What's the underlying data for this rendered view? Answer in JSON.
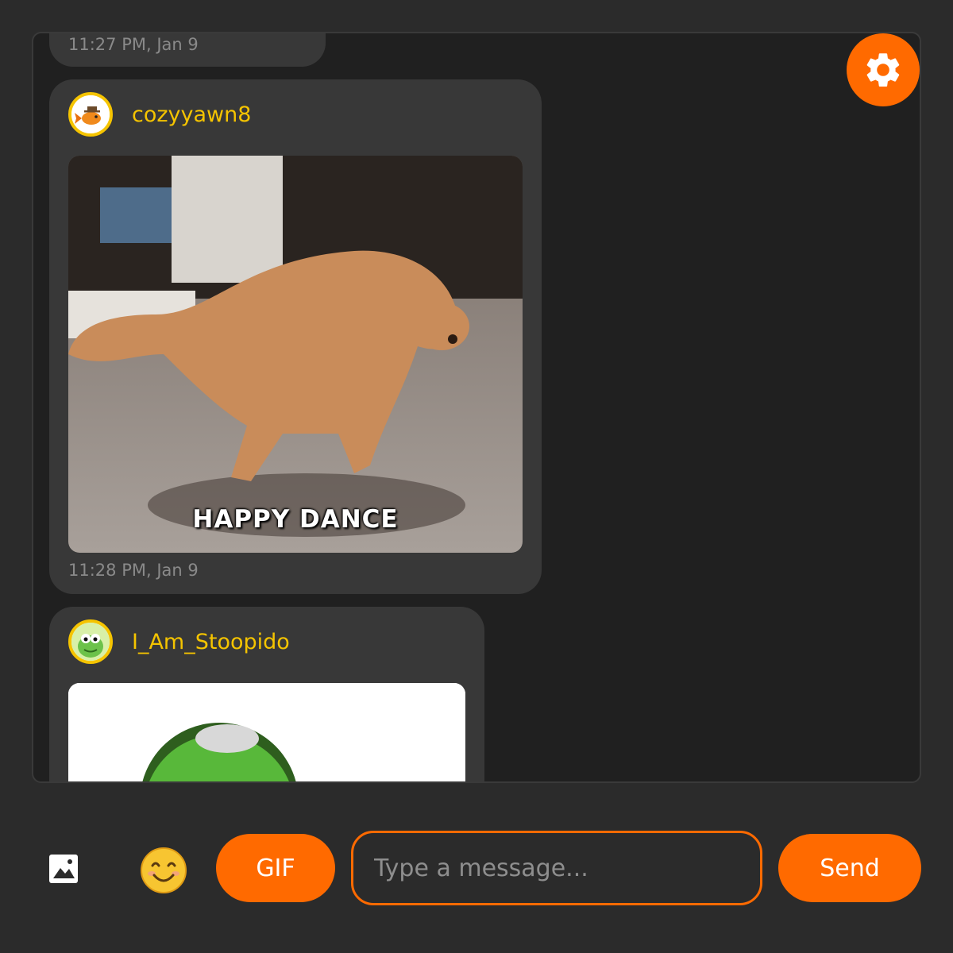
{
  "colors": {
    "accent": "#ff6a00",
    "username": "#f5c400",
    "background": "#2b2b2b",
    "panel": "#202020",
    "bubble": "#383838",
    "timestamp": "#8a8a8a"
  },
  "settings": {
    "icon": "gear-icon"
  },
  "messages": [
    {
      "time": "11:27 PM, Jan 9"
    },
    {
      "username": "cozyyawn8",
      "avatar_icon": "goldfish-with-hat-avatar",
      "media": {
        "type": "gif",
        "caption": "HAPPY DANCE",
        "subject": "dancing-dog"
      },
      "time": "11:28 PM, Jan 9"
    },
    {
      "username": "I_Am_Stoopido",
      "avatar_icon": "green-cartoon-avatar",
      "media": {
        "type": "gif",
        "subject": "green-frog-head"
      }
    }
  ],
  "composer": {
    "image_icon": "image-icon",
    "emoji": "😊",
    "gif_label": "GIF",
    "placeholder": "Type a message...",
    "send_label": "Send"
  }
}
